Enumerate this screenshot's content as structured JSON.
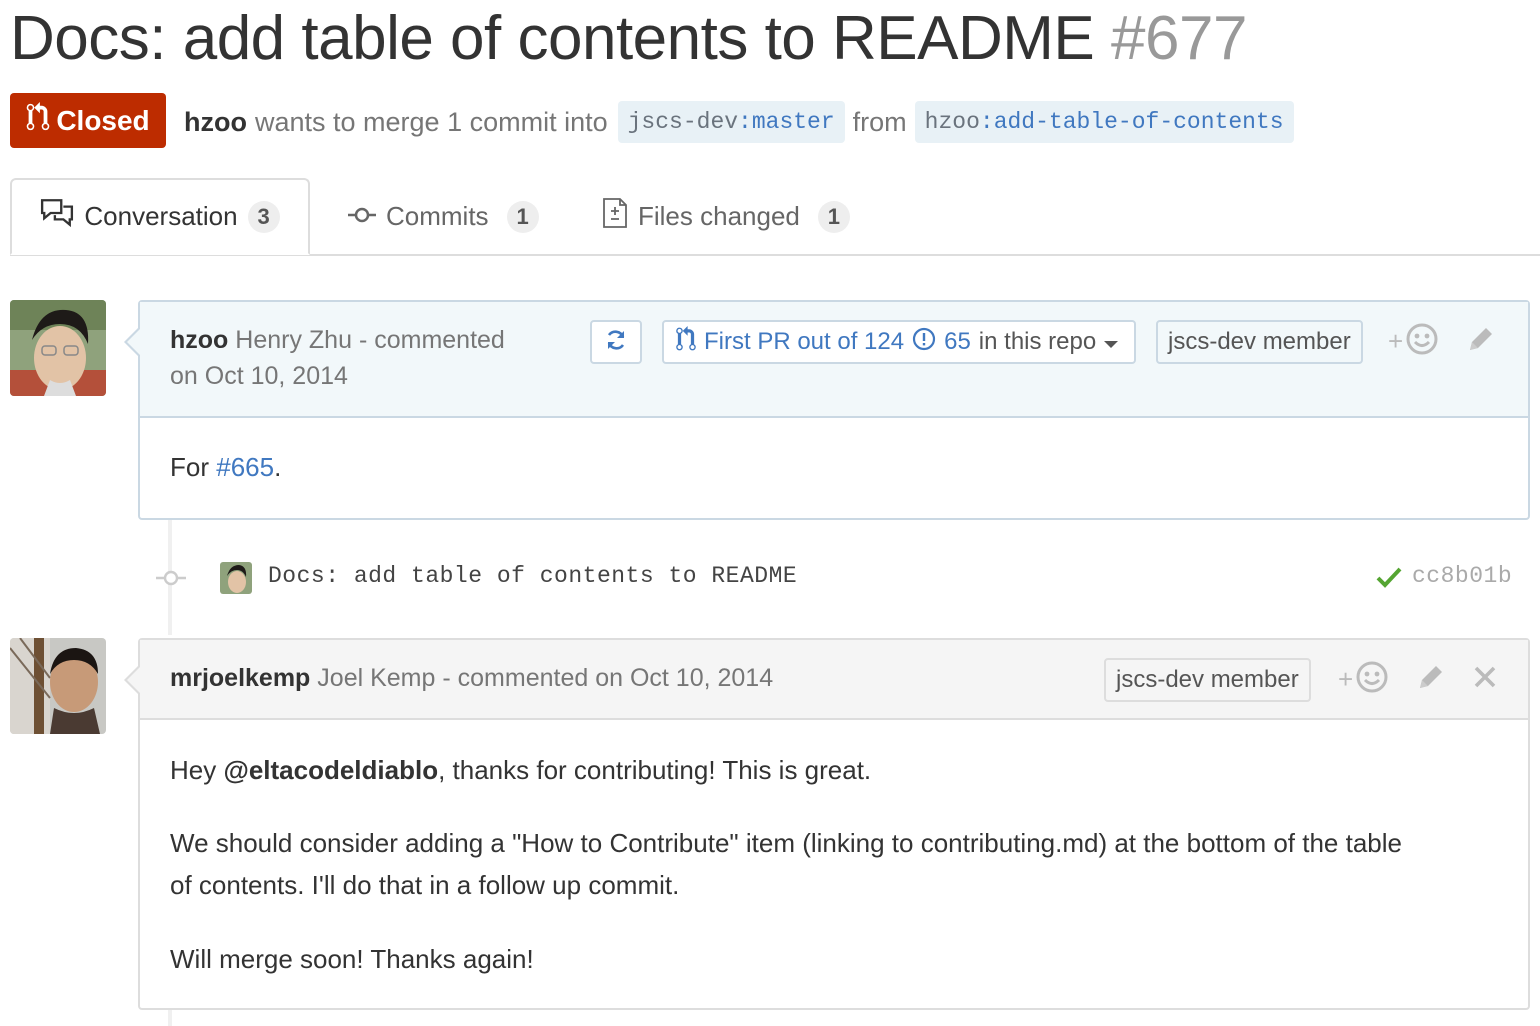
{
  "pr": {
    "title": "Docs: add table of contents to README",
    "number": "#677",
    "state": "Closed",
    "author": "hzoo",
    "merge_text": "wants to merge 1 commit into",
    "base_repo": "jscs-dev",
    "base_branch": ":master",
    "from_text": "from",
    "head_repo": "hzoo",
    "head_branch": ":add-table-of-contents"
  },
  "tabs": [
    {
      "label": "Conversation",
      "count": "3",
      "icon": "comment-discussion-icon",
      "selected": true
    },
    {
      "label": "Commits",
      "count": "1",
      "icon": "git-commit-icon",
      "selected": false
    },
    {
      "label": "Files changed",
      "count": "1",
      "icon": "file-diff-icon",
      "selected": false
    }
  ],
  "comments": [
    {
      "username": "hzoo",
      "fullname": "Henry Zhu",
      "action_line1": "- commented",
      "action_line2": "on Oct 10, 2014",
      "first_pr_prefix": "First PR out of 124",
      "issues_count": "65",
      "issues_suffix": "in this repo",
      "badge": "jscs-dev member",
      "body_prefix": "For ",
      "body_link": "#665",
      "body_suffix": "."
    },
    {
      "username": "mrjoelkemp",
      "fullname": "Joel Kemp",
      "action": "- commented on Oct 10, 2014",
      "badge": "jscs-dev member",
      "p1_prefix": "Hey ",
      "p1_mention": "@eltacodeldiablo",
      "p1_suffix": ", thanks for contributing! This is great.",
      "p2_line1": "We should consider adding a \"How to Contribute\" item (linking to contributing.md) at the bottom of the table",
      "p2_line2": "of contents. I'll do that in a follow up commit.",
      "p3": "Will merge soon! Thanks again!"
    }
  ],
  "commit": {
    "message": "Docs: add table of contents to README",
    "sha": "cc8b01b",
    "status": "success"
  },
  "colors": {
    "closed_state": "#bd2c00",
    "link": "#4078c0",
    "success": "#55a532"
  }
}
